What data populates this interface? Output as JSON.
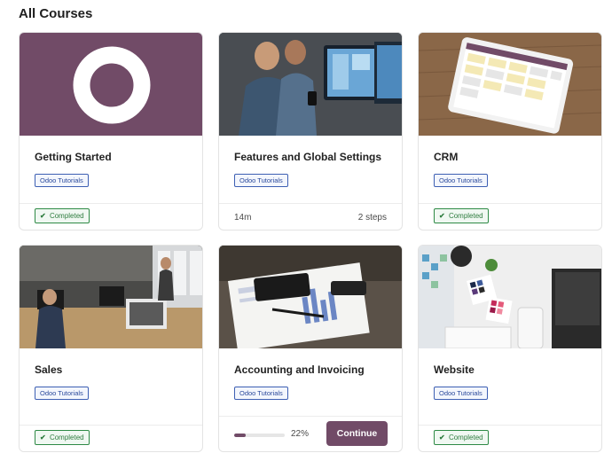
{
  "page": {
    "title": "All Courses"
  },
  "courses": [
    {
      "title": "Getting Started",
      "tag": "Odoo Tutorials",
      "status": "Completed"
    },
    {
      "title": "Features and Global Settings",
      "tag": "Odoo Tutorials",
      "duration": "14m",
      "steps": "2 steps"
    },
    {
      "title": "CRM",
      "tag": "Odoo Tutorials",
      "status": "Completed"
    },
    {
      "title": "Sales",
      "tag": "Odoo Tutorials",
      "status": "Completed"
    },
    {
      "title": "Accounting and Invoicing",
      "tag": "Odoo Tutorials",
      "progress": 0.22,
      "progress_label": "22%",
      "action": "Continue"
    },
    {
      "title": "Website",
      "tag": "Odoo Tutorials",
      "status": "Completed"
    }
  ],
  "icons": {
    "check": "✔"
  },
  "colors": {
    "brand": "#714b67",
    "tag_border": "#3d5fb3",
    "completed": "#2e8a45"
  }
}
